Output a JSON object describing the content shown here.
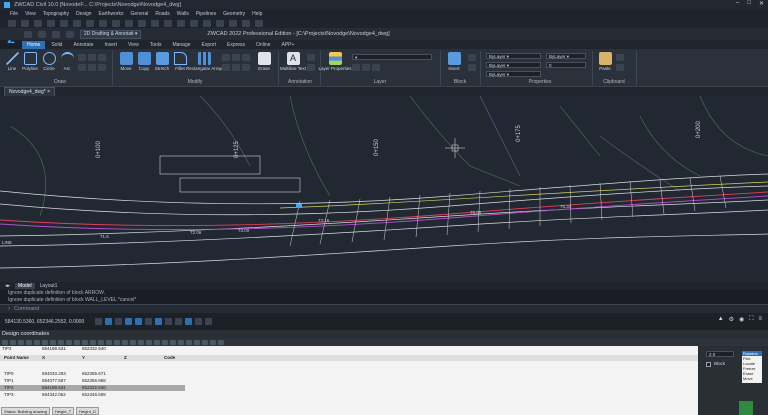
{
  "window": {
    "title": "ZWCAD Civil 10.0 [NovodeF... C:\\Projects\\Novodge\\Novodge4_dwg]"
  },
  "menu": [
    "File",
    "View",
    "Topography",
    "Design",
    "Earthworks",
    "General",
    "Roads",
    "Walls",
    "Pipelines",
    "Geometry",
    "Help"
  ],
  "app_bar": {
    "workspace": "2D Drafting & Annotati",
    "doc_title": "ZWCAD 2022 Professional Edition - [C:\\Projects\\Novodge\\Novodge4_dwg]"
  },
  "ribbon_tabs": [
    "Home",
    "Solid",
    "Annotate",
    "Insert",
    "View",
    "Tools",
    "Manage",
    "Export",
    "Express",
    "Online",
    "APP+"
  ],
  "ribbon": {
    "draw": [
      "Line",
      "Polyline",
      "Circle",
      "Arc"
    ],
    "modify": [
      "Move",
      "Copy",
      "Stretch",
      "Fillet",
      "Rectangular Array"
    ],
    "other": [
      "Erase"
    ],
    "annotation": [
      "Multiline Text"
    ],
    "layers": [
      "Layer Properties"
    ],
    "block": [
      "Insert"
    ],
    "clipboard": [
      "Paste"
    ],
    "groups": [
      "Draw",
      "Modify",
      "Annotation",
      "Layer",
      "Block",
      "Properties",
      "Clipboard"
    ],
    "properties": {
      "color": "ByLayer",
      "linetype": "ByLayer",
      "lineweight": "ByLayer",
      "layer_value": "0"
    }
  },
  "file_tab": "Novodge4_dwg*",
  "drawing": {
    "stations": [
      "0+100",
      "0+125",
      "0+150",
      "0+175",
      "0+200"
    ],
    "labels": [
      "72.06",
      "73.00",
      "73.16",
      "75.06",
      "71.6",
      "LINE",
      "75.34"
    ]
  },
  "layout_tabs": [
    "Model",
    "Layout1"
  ],
  "command_history": [
    "Ignore duplicate definition of block ARROW.",
    "Ignore duplicate definition of block WALL_LEVEL *cancel*"
  ],
  "command_placeholder": "Command",
  "status": {
    "coords": "584130.5360, 652346.2552, 0.0000"
  },
  "design_panel": {
    "title": "Design coordinates",
    "top_row": {
      "name": "TIP2",
      "x": "584189.531",
      "y": "652332.540"
    },
    "columns": [
      "Point Name",
      "X",
      "Y",
      "Z",
      "Code"
    ],
    "rows": [
      {
        "name": "TIP0",
        "x": "584033.293",
        "y": "652365.671"
      },
      {
        "name": "TIP1",
        "x": "584077.567",
        "y": "652356.968"
      },
      {
        "name": "TIP2",
        "x": "584189.531",
        "y": "652332.540"
      },
      {
        "name": "TIP3",
        "x": "584342.062",
        "y": "652346.608"
      }
    ],
    "status_tabs": [
      "Status: Building drawing",
      "Height_T",
      "Height_D"
    ]
  },
  "side_panel": {
    "value": "2.0",
    "block_label": "Block",
    "options": [
      "Rotation",
      "Pick",
      "Locate",
      "Freeze",
      "Erase",
      "Move"
    ]
  },
  "colors": {
    "accent": "#2f6fb3",
    "canvas": "#222831",
    "selected_row": "#a8a8a8"
  }
}
